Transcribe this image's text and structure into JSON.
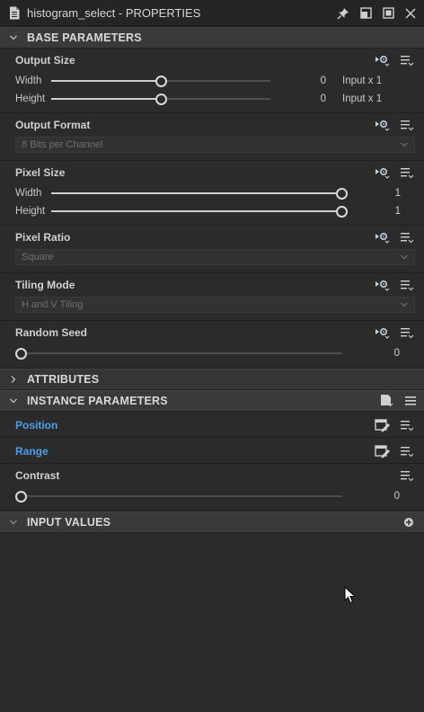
{
  "window": {
    "title": "histogram_select - PROPERTIES"
  },
  "icons": {
    "document": "document-icon",
    "pin": "pin-icon",
    "float": "float-window-icon",
    "maximize": "maximize-icon",
    "close": "close-icon"
  },
  "sections": {
    "base": {
      "label": "BASE PARAMETERS",
      "expanded": true
    },
    "attributes": {
      "label": "ATTRIBUTES",
      "expanded": false
    },
    "instance": {
      "label": "INSTANCE PARAMETERS",
      "expanded": true
    },
    "inputs": {
      "label": "INPUT VALUES",
      "expanded": true
    }
  },
  "base": {
    "output_size": {
      "title": "Output Size",
      "width": {
        "label": "Width",
        "value": "0",
        "suffix": "Input x 1",
        "slider_fraction": 0.5
      },
      "height": {
        "label": "Height",
        "value": "0",
        "suffix": "Input x 1",
        "slider_fraction": 0.5
      }
    },
    "output_format": {
      "title": "Output Format",
      "selected": "8 Bits per Channel"
    },
    "pixel_size": {
      "title": "Pixel Size",
      "width": {
        "label": "Width",
        "value": "1",
        "slider_fraction": 1.0
      },
      "height": {
        "label": "Height",
        "value": "1",
        "slider_fraction": 1.0
      }
    },
    "pixel_ratio": {
      "title": "Pixel Ratio",
      "selected": "Square"
    },
    "tiling_mode": {
      "title": "Tiling Mode",
      "selected": "H and V Tiling"
    },
    "random_seed": {
      "title": "Random Seed",
      "value": "0",
      "slider_fraction": 0.0
    }
  },
  "instance": {
    "position": {
      "title": "Position"
    },
    "range": {
      "title": "Range"
    },
    "contrast": {
      "title": "Contrast",
      "value": "0",
      "slider_fraction": 0.0
    }
  },
  "colors": {
    "link": "#4a9fe8",
    "background": "#2b2b2b",
    "header": "#3a3a3a"
  }
}
